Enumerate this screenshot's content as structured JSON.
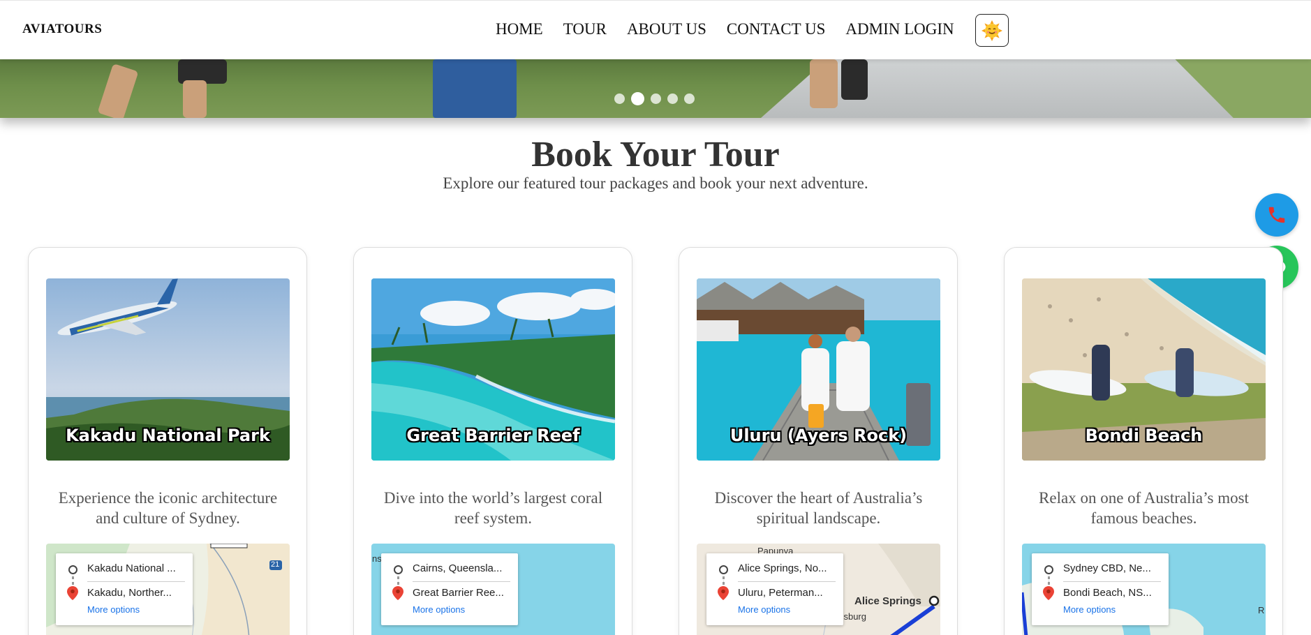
{
  "brand": "AVIATOURS",
  "nav": {
    "items": [
      "HOME",
      "TOUR",
      "ABOUT US",
      "CONTACT US",
      "ADMIN LOGIN"
    ],
    "theme_icon": "sun-face-icon"
  },
  "hero": {
    "slide_count": 5,
    "active_slide": 2
  },
  "section": {
    "title": "Book Your Tour",
    "subtitle": "Explore our featured tour packages and book your next adventure."
  },
  "floating": {
    "call_icon": "phone-icon",
    "chat_icon": "chat-icon"
  },
  "tours": [
    {
      "name": "Kakadu National Park",
      "description": "Experience the iconic architecture and culture of Sydney.",
      "map_from": "Kakadu National ...",
      "map_to": "Kakadu, Norther...",
      "map_more": "More options",
      "map_extra": "21"
    },
    {
      "name": "Great Barrier Reef",
      "description": "Dive into the world’s largest coral reef system.",
      "map_from": "Cairns, Queensla...",
      "map_to": "Great Barrier Ree...",
      "map_more": "More options",
      "map_extra": "ns"
    },
    {
      "name": "Uluru (Ayers Rock)",
      "description": "Discover the heart of Australia’s spiritual landscape.",
      "map_from": "Alice Springs, No...",
      "map_to": "Uluru, Peterman...",
      "map_more": "More options",
      "map_extra": "Papunya",
      "map_city": "Alice Springs",
      "map_extra2": "nnsburg"
    },
    {
      "name": "Bondi Beach",
      "description": "Relax on one of Australia’s most famous beaches.",
      "map_from": "Sydney CBD, Ne...",
      "map_to": "Bondi Beach, NS...",
      "map_more": "More options",
      "map_extra": "R"
    }
  ],
  "colors": {
    "call": "#1e9be6",
    "chat": "#27c55a",
    "link": "#1a73e8",
    "heading": "#333333"
  }
}
